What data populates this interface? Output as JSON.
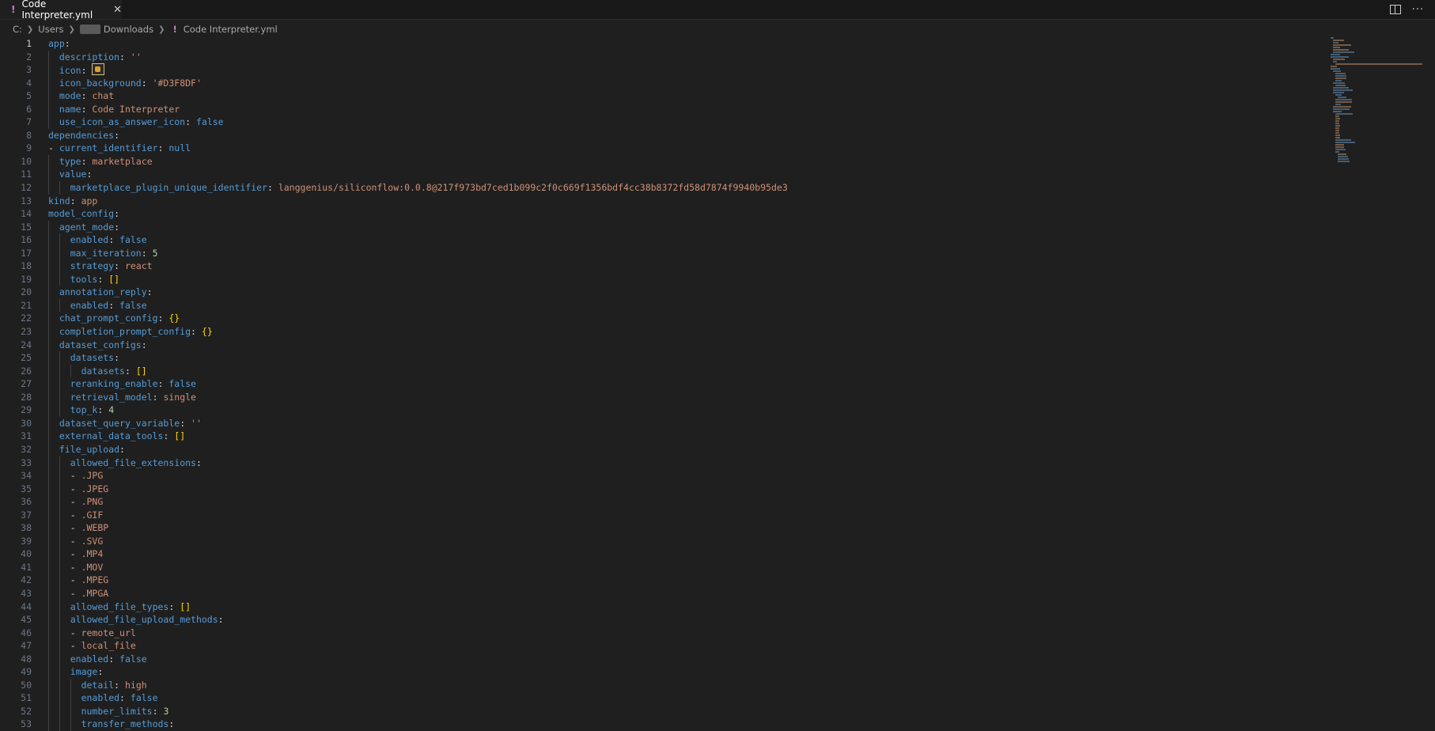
{
  "tab": {
    "title": "Code Interpreter.yml",
    "icon": "yaml-exclamation-icon",
    "close_icon": "close-icon"
  },
  "breadcrumb": {
    "items": [
      "C:",
      "Users",
      "Downloads",
      "Code Interpreter.yml"
    ]
  },
  "editor_lines": [
    {
      "n": "1",
      "indent": 0,
      "parts": [
        [
          "key",
          "app"
        ],
        [
          "punc",
          ":"
        ]
      ]
    },
    {
      "n": "2",
      "indent": 1,
      "parts": [
        [
          "key",
          "description"
        ],
        [
          "punc",
          ": "
        ],
        [
          "str",
          "''"
        ]
      ]
    },
    {
      "n": "3",
      "indent": 1,
      "parts": [
        [
          "key",
          "icon"
        ],
        [
          "punc",
          ": "
        ],
        [
          "emoji",
          ""
        ]
      ]
    },
    {
      "n": "4",
      "indent": 1,
      "parts": [
        [
          "key",
          "icon_background"
        ],
        [
          "punc",
          ": "
        ],
        [
          "str",
          "'#D3F8DF'"
        ]
      ]
    },
    {
      "n": "5",
      "indent": 1,
      "parts": [
        [
          "key",
          "mode"
        ],
        [
          "punc",
          ": "
        ],
        [
          "str",
          "chat"
        ]
      ]
    },
    {
      "n": "6",
      "indent": 1,
      "parts": [
        [
          "key",
          "name"
        ],
        [
          "punc",
          ": "
        ],
        [
          "str",
          "Code Interpreter"
        ]
      ]
    },
    {
      "n": "7",
      "indent": 1,
      "parts": [
        [
          "key",
          "use_icon_as_answer_icon"
        ],
        [
          "punc",
          ": "
        ],
        [
          "bool",
          "false"
        ]
      ]
    },
    {
      "n": "8",
      "indent": 0,
      "parts": [
        [
          "key",
          "dependencies"
        ],
        [
          "punc",
          ":"
        ]
      ]
    },
    {
      "n": "9",
      "indent": 0,
      "parts": [
        [
          "dash",
          "- "
        ],
        [
          "key",
          "current_identifier"
        ],
        [
          "punc",
          ": "
        ],
        [
          "bool",
          "null"
        ]
      ]
    },
    {
      "n": "10",
      "indent": 1,
      "parts": [
        [
          "key",
          "type"
        ],
        [
          "punc",
          ": "
        ],
        [
          "str",
          "marketplace"
        ]
      ]
    },
    {
      "n": "11",
      "indent": 1,
      "parts": [
        [
          "key",
          "value"
        ],
        [
          "punc",
          ":"
        ]
      ]
    },
    {
      "n": "12",
      "indent": 2,
      "parts": [
        [
          "key",
          "marketplace_plugin_unique_identifier"
        ],
        [
          "punc",
          ": "
        ],
        [
          "str",
          "langgenius/siliconflow:0.0.8@217f973bd7ced1b099c2f0c669f1356bdf4cc38b8372fd58d7874f9940b95de3"
        ]
      ]
    },
    {
      "n": "13",
      "indent": 0,
      "parts": [
        [
          "key",
          "kind"
        ],
        [
          "punc",
          ": "
        ],
        [
          "str",
          "app"
        ]
      ]
    },
    {
      "n": "14",
      "indent": 0,
      "parts": [
        [
          "key",
          "model_config"
        ],
        [
          "punc",
          ":"
        ]
      ]
    },
    {
      "n": "15",
      "indent": 1,
      "parts": [
        [
          "key",
          "agent_mode"
        ],
        [
          "punc",
          ":"
        ]
      ]
    },
    {
      "n": "16",
      "indent": 2,
      "parts": [
        [
          "key",
          "enabled"
        ],
        [
          "punc",
          ": "
        ],
        [
          "bool",
          "false"
        ]
      ]
    },
    {
      "n": "17",
      "indent": 2,
      "parts": [
        [
          "key",
          "max_iteration"
        ],
        [
          "punc",
          ": "
        ],
        [
          "num",
          "5"
        ]
      ]
    },
    {
      "n": "18",
      "indent": 2,
      "parts": [
        [
          "key",
          "strategy"
        ],
        [
          "punc",
          ": "
        ],
        [
          "str",
          "react"
        ]
      ]
    },
    {
      "n": "19",
      "indent": 2,
      "parts": [
        [
          "key",
          "tools"
        ],
        [
          "punc",
          ": "
        ],
        [
          "bracket",
          "[]"
        ]
      ]
    },
    {
      "n": "20",
      "indent": 1,
      "parts": [
        [
          "key",
          "annotation_reply"
        ],
        [
          "punc",
          ":"
        ]
      ]
    },
    {
      "n": "21",
      "indent": 2,
      "parts": [
        [
          "key",
          "enabled"
        ],
        [
          "punc",
          ": "
        ],
        [
          "bool",
          "false"
        ]
      ]
    },
    {
      "n": "22",
      "indent": 1,
      "parts": [
        [
          "key",
          "chat_prompt_config"
        ],
        [
          "punc",
          ": "
        ],
        [
          "bracket",
          "{}"
        ]
      ]
    },
    {
      "n": "23",
      "indent": 1,
      "parts": [
        [
          "key",
          "completion_prompt_config"
        ],
        [
          "punc",
          ": "
        ],
        [
          "bracket",
          "{}"
        ]
      ]
    },
    {
      "n": "24",
      "indent": 1,
      "parts": [
        [
          "key",
          "dataset_configs"
        ],
        [
          "punc",
          ":"
        ]
      ]
    },
    {
      "n": "25",
      "indent": 2,
      "parts": [
        [
          "key",
          "datasets"
        ],
        [
          "punc",
          ":"
        ]
      ]
    },
    {
      "n": "26",
      "indent": 3,
      "parts": [
        [
          "key",
          "datasets"
        ],
        [
          "punc",
          ": "
        ],
        [
          "bracket",
          "[]"
        ]
      ]
    },
    {
      "n": "27",
      "indent": 2,
      "parts": [
        [
          "key",
          "reranking_enable"
        ],
        [
          "punc",
          ": "
        ],
        [
          "bool",
          "false"
        ]
      ]
    },
    {
      "n": "28",
      "indent": 2,
      "parts": [
        [
          "key",
          "retrieval_model"
        ],
        [
          "punc",
          ": "
        ],
        [
          "str",
          "single"
        ]
      ]
    },
    {
      "n": "29",
      "indent": 2,
      "parts": [
        [
          "key",
          "top_k"
        ],
        [
          "punc",
          ": "
        ],
        [
          "num",
          "4"
        ]
      ]
    },
    {
      "n": "30",
      "indent": 1,
      "parts": [
        [
          "key",
          "dataset_query_variable"
        ],
        [
          "punc",
          ": "
        ],
        [
          "str",
          "''"
        ]
      ]
    },
    {
      "n": "31",
      "indent": 1,
      "parts": [
        [
          "key",
          "external_data_tools"
        ],
        [
          "punc",
          ": "
        ],
        [
          "bracket",
          "[]"
        ]
      ]
    },
    {
      "n": "32",
      "indent": 1,
      "parts": [
        [
          "key",
          "file_upload"
        ],
        [
          "punc",
          ":"
        ]
      ]
    },
    {
      "n": "33",
      "indent": 2,
      "parts": [
        [
          "key",
          "allowed_file_extensions"
        ],
        [
          "punc",
          ":"
        ]
      ]
    },
    {
      "n": "34",
      "indent": 2,
      "parts": [
        [
          "dash",
          "- "
        ],
        [
          "str",
          ".JPG"
        ]
      ]
    },
    {
      "n": "35",
      "indent": 2,
      "parts": [
        [
          "dash",
          "- "
        ],
        [
          "str",
          ".JPEG"
        ]
      ]
    },
    {
      "n": "36",
      "indent": 2,
      "parts": [
        [
          "dash",
          "- "
        ],
        [
          "str",
          ".PNG"
        ]
      ]
    },
    {
      "n": "37",
      "indent": 2,
      "parts": [
        [
          "dash",
          "- "
        ],
        [
          "str",
          ".GIF"
        ]
      ]
    },
    {
      "n": "38",
      "indent": 2,
      "parts": [
        [
          "dash",
          "- "
        ],
        [
          "str",
          ".WEBP"
        ]
      ]
    },
    {
      "n": "39",
      "indent": 2,
      "parts": [
        [
          "dash",
          "- "
        ],
        [
          "str",
          ".SVG"
        ]
      ]
    },
    {
      "n": "40",
      "indent": 2,
      "parts": [
        [
          "dash",
          "- "
        ],
        [
          "str",
          ".MP4"
        ]
      ]
    },
    {
      "n": "41",
      "indent": 2,
      "parts": [
        [
          "dash",
          "- "
        ],
        [
          "str",
          ".MOV"
        ]
      ]
    },
    {
      "n": "42",
      "indent": 2,
      "parts": [
        [
          "dash",
          "- "
        ],
        [
          "str",
          ".MPEG"
        ]
      ]
    },
    {
      "n": "43",
      "indent": 2,
      "parts": [
        [
          "dash",
          "- "
        ],
        [
          "str",
          ".MPGA"
        ]
      ]
    },
    {
      "n": "44",
      "indent": 2,
      "parts": [
        [
          "key",
          "allowed_file_types"
        ],
        [
          "punc",
          ": "
        ],
        [
          "bracket",
          "[]"
        ]
      ]
    },
    {
      "n": "45",
      "indent": 2,
      "parts": [
        [
          "key",
          "allowed_file_upload_methods"
        ],
        [
          "punc",
          ":"
        ]
      ]
    },
    {
      "n": "46",
      "indent": 2,
      "parts": [
        [
          "dash",
          "- "
        ],
        [
          "str",
          "remote_url"
        ]
      ]
    },
    {
      "n": "47",
      "indent": 2,
      "parts": [
        [
          "dash",
          "- "
        ],
        [
          "str",
          "local_file"
        ]
      ]
    },
    {
      "n": "48",
      "indent": 2,
      "parts": [
        [
          "key",
          "enabled"
        ],
        [
          "punc",
          ": "
        ],
        [
          "bool",
          "false"
        ]
      ]
    },
    {
      "n": "49",
      "indent": 2,
      "parts": [
        [
          "key",
          "image"
        ],
        [
          "punc",
          ":"
        ]
      ]
    },
    {
      "n": "50",
      "indent": 3,
      "parts": [
        [
          "key",
          "detail"
        ],
        [
          "punc",
          ": "
        ],
        [
          "str",
          "high"
        ]
      ]
    },
    {
      "n": "51",
      "indent": 3,
      "parts": [
        [
          "key",
          "enabled"
        ],
        [
          "punc",
          ": "
        ],
        [
          "bool",
          "false"
        ]
      ]
    },
    {
      "n": "52",
      "indent": 3,
      "parts": [
        [
          "key",
          "number_limits"
        ],
        [
          "punc",
          ": "
        ],
        [
          "num",
          "3"
        ]
      ]
    },
    {
      "n": "53",
      "indent": 3,
      "parts": [
        [
          "key",
          "transfer_methods"
        ],
        [
          "punc",
          ":"
        ]
      ]
    }
  ]
}
